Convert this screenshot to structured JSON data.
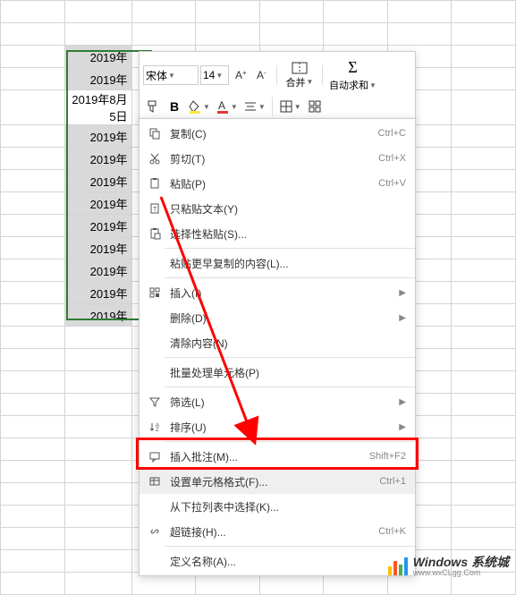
{
  "cells": {
    "col1": [
      "2019年",
      "2019年",
      "2019年8月5日",
      "2019年",
      "2019年",
      "2019年",
      "2019年",
      "2019年",
      "2019年",
      "2019年",
      "2019年",
      "2019年"
    ]
  },
  "toolbar": {
    "font": "宋体",
    "size": "14",
    "merge": "合并",
    "autosum": "自动求和"
  },
  "menu": {
    "copy": "复制(C)",
    "cut": "剪切(T)",
    "paste": "粘贴(P)",
    "paste_text": "只粘贴文本(Y)",
    "paste_special": "选择性粘贴(S)...",
    "paste_recent": "粘贴更早复制的内容(L)...",
    "insert": "插入(I)",
    "delete": "删除(D)",
    "clear": "清除内容(N)",
    "batch": "批量处理单元格(P)",
    "filter": "筛选(L)",
    "sort": "排序(U)",
    "comment": "插入批注(M)...",
    "format": "设置单元格格式(F)...",
    "dropdown": "从下拉列表中选择(K)...",
    "hyperlink": "超链接(H)...",
    "define_name": "定义名称(A)...",
    "sc_copy": "Ctrl+C",
    "sc_cut": "Ctrl+X",
    "sc_paste": "Ctrl+V",
    "sc_comment": "Shift+F2",
    "sc_format": "Ctrl+1",
    "sc_hyperlink": "Ctrl+K"
  },
  "watermark": {
    "title": "Windows 系统城",
    "url": "www.wxCLgg.Com"
  }
}
